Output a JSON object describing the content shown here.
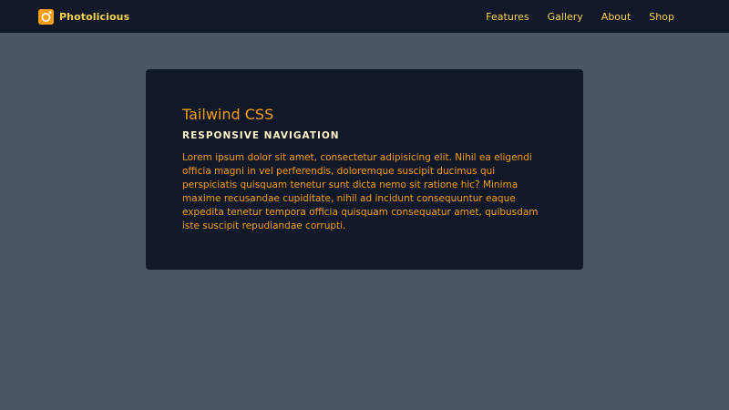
{
  "navbar": {
    "brand": {
      "name": "Photolicious",
      "icon": "camera-icon"
    },
    "links": [
      {
        "label": "Features"
      },
      {
        "label": "Gallery"
      },
      {
        "label": "About"
      },
      {
        "label": "Shop"
      }
    ]
  },
  "card": {
    "title": "Tailwind CSS",
    "subtitle": "RESPONSIVE NAVIGATION",
    "body": "Lorem ipsum dolor sit amet, consectetur adipisicing elit. Nihil ea eligendi officia magni in vel perferendis, doloremque suscipit ducimus qui perspiciatis quisquam tenetur sunt dicta nemo sit ratione hic? Minima maxime recusandae cupiditate, nihil ad incidunt consequuntur eaque expedita tenetur tempora officia quisquam consequatur amet, quibusdam iste suscipit repudiandae corrupti."
  },
  "colors": {
    "page_background": "#4b5563",
    "navbar_background": "#111827",
    "card_background": "#111827",
    "accent": "#f59e0b",
    "nav_text": "#fcd34d",
    "subtitle_text": "#fef3c7"
  }
}
